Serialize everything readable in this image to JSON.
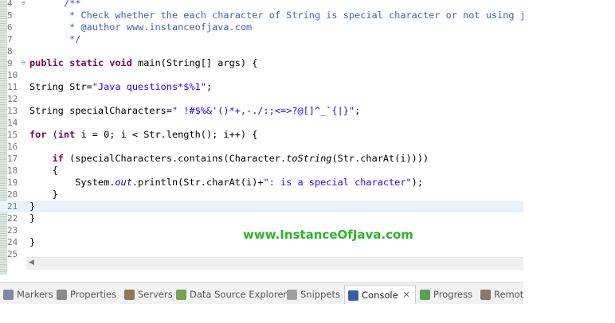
{
  "editor": {
    "lines": [
      {
        "n": "4",
        "fold": "⊖",
        "parts": [
          [
            "      /**",
            "doc"
          ]
        ]
      },
      {
        "n": "5",
        "parts": [
          [
            "       * Check whether the each character of String is special character or not using java",
            "doc"
          ]
        ]
      },
      {
        "n": "6",
        "parts": [
          [
            "       * @author www.instanceofjava.com",
            "doc"
          ]
        ]
      },
      {
        "n": "7",
        "parts": [
          [
            "       */",
            "doc"
          ]
        ]
      },
      {
        "n": "8",
        "parts": []
      },
      {
        "n": "9",
        "fold": "⊖",
        "parts": [
          [
            "public static void ",
            "kw"
          ],
          [
            "main(String[] args) {",
            ""
          ]
        ]
      },
      {
        "n": "10",
        "parts": []
      },
      {
        "n": "11",
        "parts": [
          [
            "String Str=",
            ""
          ],
          [
            "\"Java questions*$%1\"",
            "str"
          ],
          [
            ";",
            ""
          ]
        ]
      },
      {
        "n": "12",
        "parts": []
      },
      {
        "n": "13",
        "parts": [
          [
            "String specialCharacters=",
            ""
          ],
          [
            "\" !#$%&'()*+,-./:;<=>?@[]^_`{|}\"",
            "str"
          ],
          [
            ";",
            ""
          ]
        ]
      },
      {
        "n": "14",
        "parts": []
      },
      {
        "n": "15",
        "parts": [
          [
            "for ",
            "kw"
          ],
          [
            "(",
            ""
          ],
          [
            "int ",
            "kw"
          ],
          [
            "i = 0; i < Str.length(); i++) {",
            ""
          ]
        ]
      },
      {
        "n": "16",
        "parts": []
      },
      {
        "n": "17",
        "parts": [
          [
            "    ",
            ""
          ],
          [
            "if ",
            "kw"
          ],
          [
            "(specialCharacters.contains(Character.",
            ""
          ],
          [
            "toString",
            "it"
          ],
          [
            "(Str.charAt(i))))",
            ""
          ]
        ]
      },
      {
        "n": "18",
        "parts": [
          [
            "    {",
            ""
          ]
        ]
      },
      {
        "n": "19",
        "parts": [
          [
            "        System.",
            ""
          ],
          [
            "out",
            "fld"
          ],
          [
            ".println(Str.charAt(i)+",
            ""
          ],
          [
            "\": is a special character\"",
            "str"
          ],
          [
            ");",
            ""
          ]
        ]
      },
      {
        "n": "20",
        "parts": [
          [
            "    }",
            ""
          ]
        ]
      },
      {
        "n": "21",
        "current": true,
        "parts": [
          [
            "}",
            ""
          ]
        ]
      },
      {
        "n": "22",
        "parts": [
          [
            "}",
            ""
          ]
        ]
      },
      {
        "n": "23",
        "parts": []
      },
      {
        "n": "24",
        "parts": [
          [
            "}",
            ""
          ]
        ]
      },
      {
        "n": "25",
        "parts": []
      }
    ]
  },
  "watermark": "www.InstanceOfJava.com",
  "tabs": [
    {
      "label": "Markers",
      "icon": "markers-icon",
      "color": "#7f8aa0"
    },
    {
      "label": "Properties",
      "icon": "properties-icon",
      "color": "#8a8a8a"
    },
    {
      "label": "Servers",
      "icon": "servers-icon",
      "color": "#8c7a5a"
    },
    {
      "label": "Data Source Explorer",
      "icon": "data-source-icon",
      "color": "#7aa05a"
    },
    {
      "label": "Snippets",
      "icon": "snippets-icon",
      "color": "#a0a0a0"
    },
    {
      "label": "Console",
      "icon": "console-icon",
      "color": "#3a5fa0",
      "active": true,
      "close": "✕"
    },
    {
      "label": "Progress",
      "icon": "progress-icon",
      "color": "#5aa05a"
    },
    {
      "label": "Remote",
      "icon": "remote-icon",
      "color": "#8a7a6a"
    }
  ]
}
